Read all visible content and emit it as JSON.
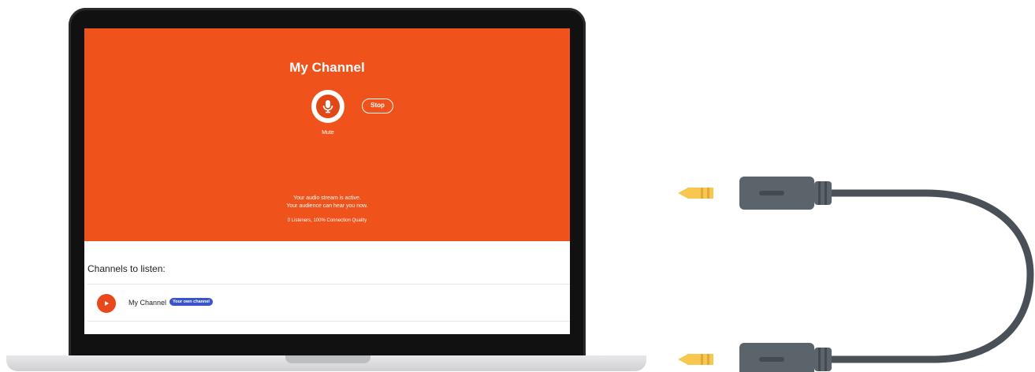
{
  "channel": {
    "title": "My Channel",
    "mute_label": "Mute",
    "stop_label": "Stop",
    "status_line_1": "Your audio stream is active.",
    "status_line_2": "Your audience can hear you now.",
    "quality": "0 Listeners, 100% Connection Quality"
  },
  "channels_list": {
    "heading": "Channels to listen:",
    "items": [
      {
        "name": "My Channel",
        "badge": "Your own channel"
      }
    ]
  },
  "colors": {
    "accent": "#f0521b",
    "badge": "#3b55c8",
    "cable": "#4a5057",
    "plug_tip": "#f7c74f"
  },
  "icons": [
    "microphone-icon",
    "play-icon",
    "audio-cable"
  ]
}
